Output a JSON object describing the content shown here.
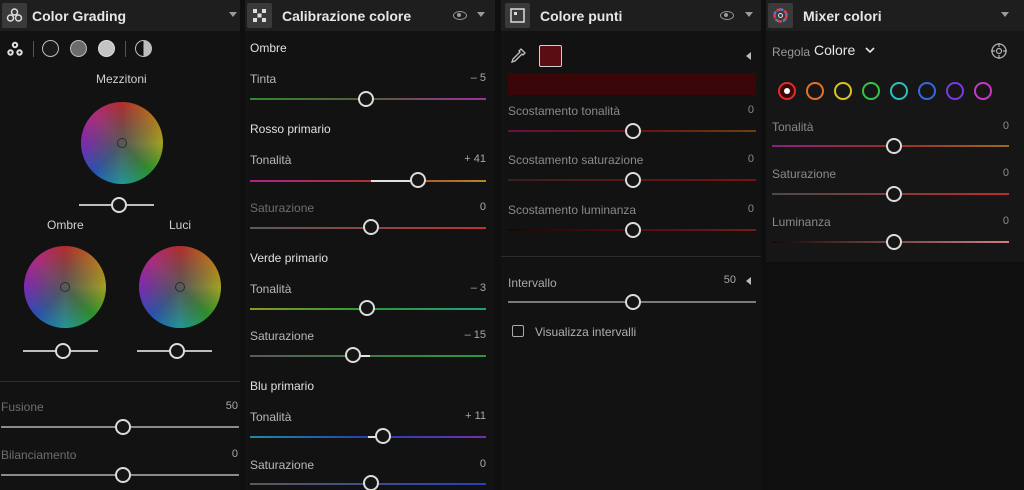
{
  "color_grading": {
    "title": "Color Grading",
    "midtones_label": "Mezzitoni",
    "shadows_label": "Ombre",
    "highlights_label": "Luci",
    "blending": {
      "label": "Fusione",
      "value": "50",
      "level": 0.5
    },
    "balance": {
      "label": "Bilanciamento",
      "value": "0",
      "level": 0.5
    }
  },
  "calibration": {
    "title": "Calibrazione colore",
    "shadows": {
      "heading": "Ombre",
      "tint": {
        "label": "Tinta",
        "value": "– 5"
      }
    },
    "red_primary": {
      "heading": "Rosso primario",
      "hue": {
        "label": "Tonalità",
        "value": "+ 41"
      },
      "saturation": {
        "label": "Saturazione",
        "value": "0"
      }
    },
    "green_primary": {
      "heading": "Verde primario",
      "hue": {
        "label": "Tonalità",
        "value": "– 3"
      },
      "saturation": {
        "label": "Saturazione",
        "value": "– 15"
      }
    },
    "blue_primary": {
      "heading": "Blu primario",
      "hue": {
        "label": "Tonalità",
        "value": "+ 11"
      },
      "saturation": {
        "label": "Saturazione",
        "value": "0"
      }
    }
  },
  "point_color": {
    "title": "Colore punti",
    "swatch_color": "#5a0d12",
    "hue_shift": {
      "label": "Scostamento tonalità",
      "value": "0"
    },
    "saturation_shift": {
      "label": "Scostamento saturazione",
      "value": "0"
    },
    "luminance_shift": {
      "label": "Scostamento luminanza",
      "value": "0"
    },
    "range": {
      "label": "Intervallo",
      "value": "50"
    },
    "show_ranges_label": "Visualizza intervalli"
  },
  "color_mixer": {
    "title": "Mixer colori",
    "adjust_label": "Regola",
    "adjust_value": "Colore",
    "swatches": [
      "#e02b2b",
      "#e0732b",
      "#d9c22b",
      "#35c24a",
      "#2bbfbf",
      "#3568e0",
      "#7a3ae0",
      "#c43ac4"
    ],
    "hue": {
      "label": "Tonalità",
      "value": "0"
    },
    "saturation": {
      "label": "Saturazione",
      "value": "0"
    },
    "luminance": {
      "label": "Luminanza",
      "value": "0"
    }
  }
}
